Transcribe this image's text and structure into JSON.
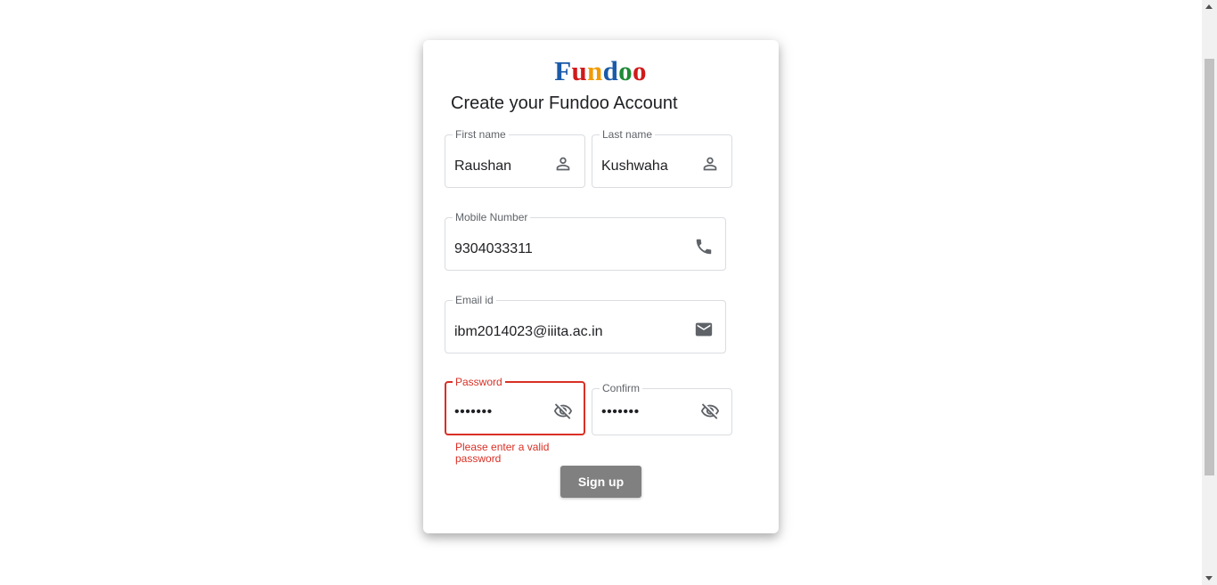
{
  "logo": {
    "letters": [
      {
        "char": "F",
        "color": "#1a5aa8"
      },
      {
        "char": "u",
        "color": "#d01a1a"
      },
      {
        "char": "n",
        "color": "#f29b05"
      },
      {
        "char": "d",
        "color": "#1a5aa8"
      },
      {
        "char": "o",
        "color": "#1f8a36"
      },
      {
        "char": "o",
        "color": "#d01a1a"
      }
    ]
  },
  "heading": "Create your Fundoo Account",
  "fields": {
    "first_name": {
      "label": "First name",
      "value": "Raushan",
      "icon": "person-icon"
    },
    "last_name": {
      "label": "Last name",
      "value": "Kushwaha",
      "icon": "person-icon"
    },
    "mobile": {
      "label": "Mobile Number",
      "value": "9304033311",
      "icon": "phone-icon"
    },
    "email": {
      "label": "Email id",
      "value": "ibm2014023@iiita.ac.in",
      "icon": "mail-icon"
    },
    "password": {
      "label": "Password",
      "value": "•••••••",
      "icon": "visibility-off-icon",
      "error": "Please enter a valid password"
    },
    "confirm": {
      "label": "Confirm",
      "value": "•••••••",
      "icon": "visibility-off-icon"
    }
  },
  "signup_label": "Sign up",
  "colors": {
    "error": "#d93025",
    "button": "#808080",
    "outline": "#dadce0"
  }
}
